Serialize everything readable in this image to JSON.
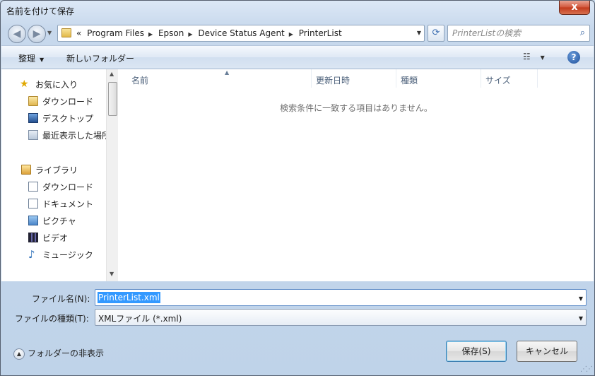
{
  "window": {
    "title": "名前を付けて保存",
    "close_label": "x"
  },
  "address": {
    "overflow": "«",
    "crumbs": [
      "Program Files",
      "Epson",
      "Device Status Agent",
      "PrinterList"
    ],
    "search_placeholder": "PrinterListの検索"
  },
  "toolbar": {
    "organize": "整理",
    "new_folder": "新しいフォルダー",
    "help": "?"
  },
  "nav": {
    "favorites": "お気に入り",
    "fav_items": [
      "ダウンロード",
      "デスクトップ",
      "最近表示した場所"
    ],
    "libraries": "ライブラリ",
    "lib_items": [
      "ダウンロード",
      "ドキュメント",
      "ピクチャ",
      "ビデオ",
      "ミュージック"
    ]
  },
  "columns": [
    "名前",
    "更新日時",
    "種類",
    "サイズ"
  ],
  "empty_message": "検索条件に一致する項目はありません。",
  "form": {
    "filename_label": "ファイル名(N):",
    "filename_value": "PrinterList.xml",
    "filetype_label": "ファイルの種類(T):",
    "filetype_value": "XMLファイル (*.xml)"
  },
  "footer": {
    "hide_folders": "フォルダーの非表示",
    "save": "保存(S)",
    "cancel": "キャンセル"
  }
}
